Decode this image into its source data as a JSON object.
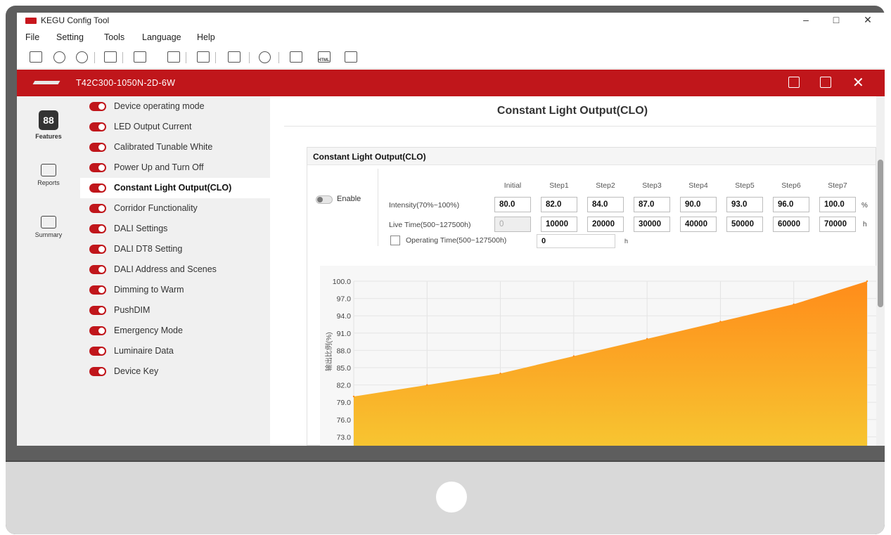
{
  "window": {
    "title": "KEGU Config Tool",
    "controls": [
      "–",
      "□",
      "✕"
    ]
  },
  "menu": [
    "File",
    "Setting",
    "Tools",
    "Language",
    "Help"
  ],
  "toolbar": {
    "icons": [
      "open-folder-icon",
      "new-icon",
      "add-icon",
      "read-device-icon",
      "write-icon",
      "export-icon",
      "compare-icon",
      "copy-icon",
      "refresh-icon",
      "report-icon",
      "html-icon",
      "print-icon"
    ],
    "html_label": "HTML"
  },
  "device": {
    "name": "T42C300-1050N-2D-6W",
    "close": "✕"
  },
  "rail": [
    {
      "label": "Features",
      "icon": "features-icon",
      "glyph": "88",
      "active": true
    },
    {
      "label": "Reports",
      "icon": "chart-icon",
      "active": false
    },
    {
      "label": "Summary",
      "icon": "summary-icon",
      "active": false
    }
  ],
  "features": [
    "Device operating mode",
    "LED Output Current",
    "Calibrated Tunable White",
    "Power Up and Turn Off",
    "Constant Light Output(CLO)",
    "Corridor Functionality",
    "DALI Settings",
    "DALI DT8 Setting",
    "DALI Address and Scenes",
    "Dimming to Warm",
    "PushDIM",
    "Emergency Mode",
    "Luminaire Data",
    "Device Key"
  ],
  "active_feature": "Constant Light Output(CLO)",
  "main": {
    "title": "Constant Light Output(CLO)",
    "panel_title": "Constant Light Output(CLO)",
    "enable_label": "Enable",
    "enabled": false,
    "columns": [
      "Initial",
      "Step1",
      "Step2",
      "Step3",
      "Step4",
      "Step5",
      "Step6",
      "Step7"
    ],
    "intensity_label": "Intensity(70%~100%)",
    "intensity_unit": "%",
    "intensity": [
      "80.0",
      "82.0",
      "84.0",
      "87.0",
      "90.0",
      "93.0",
      "96.0",
      "100.0"
    ],
    "livetime_label": "Live Time(500~127500h)",
    "livetime_unit": "h",
    "livetime": [
      "0",
      "10000",
      "20000",
      "30000",
      "40000",
      "50000",
      "60000",
      "70000"
    ],
    "operating_label": "Operating Time(500~127500h)",
    "operating_value": "0",
    "operating_unit": "h",
    "operating_checked": false
  },
  "chart_data": {
    "type": "area",
    "ylabel": "输出比例(%)",
    "yticks": [
      "100.0",
      "97.0",
      "94.0",
      "91.0",
      "88.0",
      "85.0",
      "82.0",
      "79.0",
      "76.0",
      "73.0"
    ],
    "x": [
      0,
      10000,
      20000,
      30000,
      40000,
      50000,
      60000,
      70000
    ],
    "y": [
      80.0,
      82.0,
      84.0,
      87.0,
      90.0,
      93.0,
      96.0,
      100.0
    ],
    "ylim": [
      73,
      100
    ],
    "grid": true,
    "colors": {
      "top": "#ff8c1a",
      "bottom": "#f7c531"
    }
  }
}
